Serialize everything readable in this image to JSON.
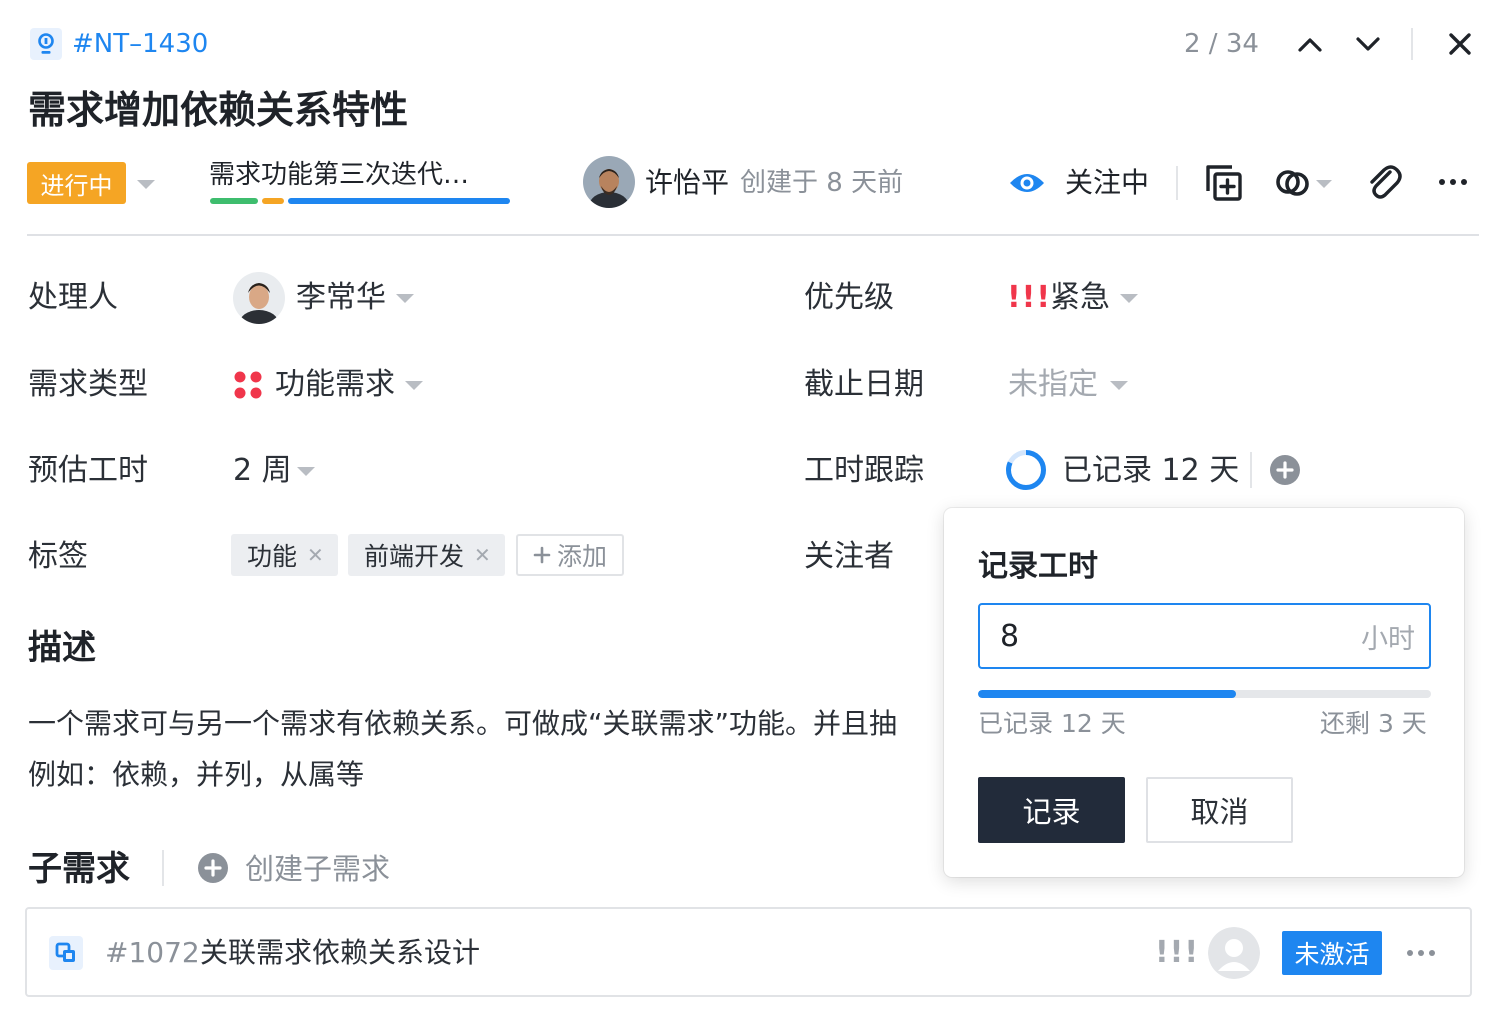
{
  "header": {
    "issue_id": "#NT–1430",
    "pager": "2 / 34",
    "title": "需求增加依赖关系特性"
  },
  "meta": {
    "status": "进行中",
    "iteration": "需求功能第三次迭代…",
    "creator": "许怡平",
    "created": "创建于 8 天前",
    "watch_label": "关注中"
  },
  "fields": {
    "assignee_label": "处理人",
    "assignee": "李常华",
    "type_label": "需求类型",
    "type": "功能需求",
    "estimate_label": "预估工时",
    "estimate": "2 周",
    "tags_label": "标签",
    "tags": [
      "功能",
      "前端开发"
    ],
    "tag_add": "添加",
    "priority_label": "优先级",
    "priority_mark": "!!!",
    "priority": "紧急",
    "due_label": "截止日期",
    "due": "未指定",
    "tracking_label": "工时跟踪",
    "tracking": "已记录 12 天",
    "watchers_label": "关注者"
  },
  "description": {
    "title": "描述",
    "line1": "一个需求可与另一个需求有依赖关系。可做成“关联需求”功能。并且抽",
    "line2": "例如：依赖，并列，从属等"
  },
  "subtasks": {
    "title": "子需求",
    "create_label": "创建子需求",
    "items": [
      {
        "id": "#1072",
        "name": "关联需求依赖关系设计",
        "priority_mark": "!!!",
        "status": "未激活"
      }
    ]
  },
  "popover": {
    "title": "记录工时",
    "input_value": "8",
    "unit": "小时",
    "progress": 0.57,
    "logged": "已记录 12 天",
    "remaining": "还剩 3 天",
    "submit": "记录",
    "cancel": "取消"
  },
  "colors": {
    "accent": "#1e86f0",
    "status_orange": "#f5a524",
    "priority_red": "#f0364b",
    "dark_button": "#222b3a"
  },
  "icons": [
    "bulb-icon",
    "chevron-up-icon",
    "chevron-down-icon",
    "close-icon",
    "eye-icon",
    "add-copy-icon",
    "link-icon",
    "attachment-icon",
    "more-icon",
    "type-dots-icon",
    "progress-ring-icon",
    "plus-circle-icon",
    "subtask-icon",
    "user-placeholder-icon"
  ]
}
